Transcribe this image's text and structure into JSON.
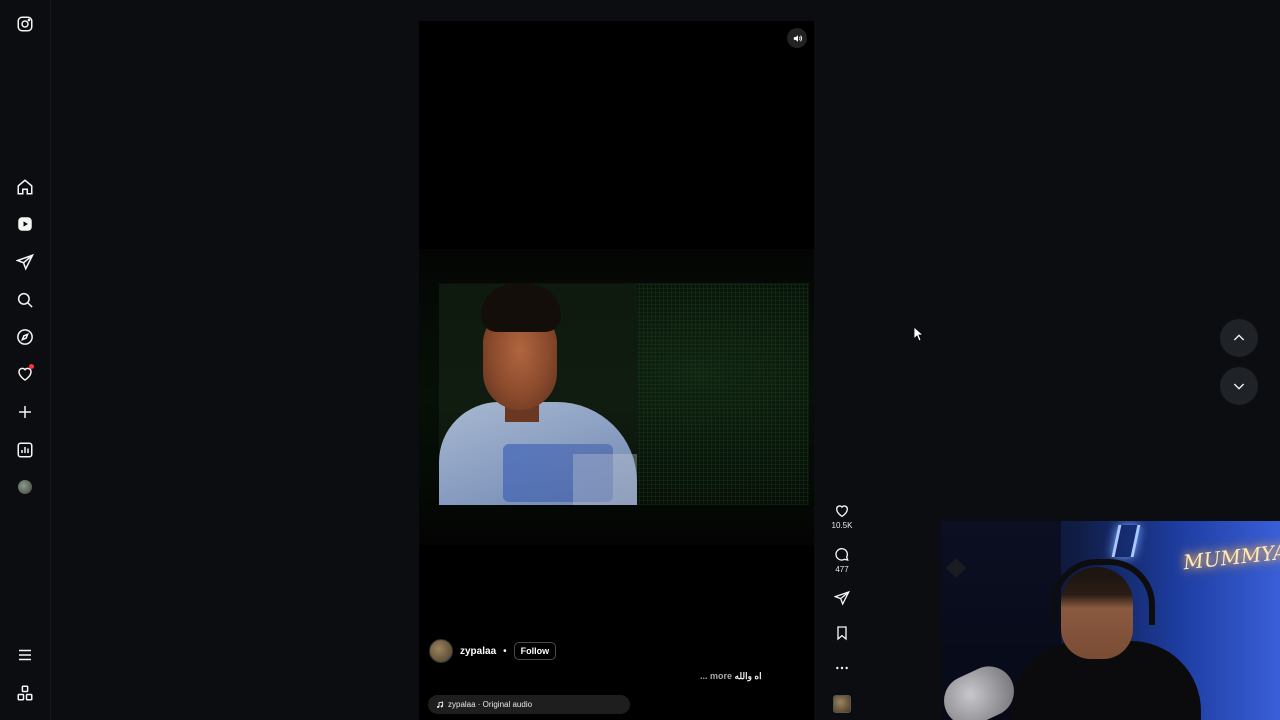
{
  "app": {
    "name": "Instagram",
    "screen": "Reels"
  },
  "sidebar": {
    "items": [
      {
        "name": "home",
        "icon": "home-icon"
      },
      {
        "name": "reels",
        "icon": "reels-icon"
      },
      {
        "name": "messages",
        "icon": "paper-plane-icon"
      },
      {
        "name": "search",
        "icon": "search-icon"
      },
      {
        "name": "explore",
        "icon": "compass-icon"
      },
      {
        "name": "notifications",
        "icon": "heart-icon"
      },
      {
        "name": "create",
        "icon": "plus-icon"
      },
      {
        "name": "dashboard",
        "icon": "bar-chart-icon"
      },
      {
        "name": "profile",
        "icon": "avatar"
      }
    ],
    "bottom": [
      {
        "name": "more",
        "icon": "menu-icon"
      },
      {
        "name": "also-from-meta",
        "icon": "apps-icon"
      }
    ]
  },
  "reel": {
    "author": "zypalaa",
    "separator": "•",
    "follow_label": "Follow",
    "caption": "اه والله",
    "more_label": "... more",
    "audio": "zypalaa · Original audio"
  },
  "actions": {
    "likes": "10.5K",
    "comments": "477"
  },
  "webcam": {
    "neon_text": "MUMMYA"
  },
  "colors": {
    "background": "#0b0d11",
    "reel_bg": "#000000",
    "notification_dot": "#ff3040",
    "webcam_blue": "#3a5fd8"
  }
}
